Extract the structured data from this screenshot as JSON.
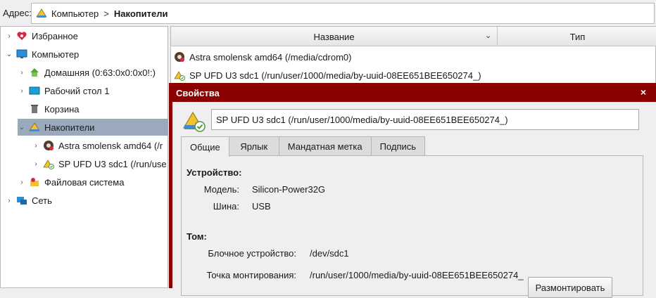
{
  "address": {
    "label": "Адрес:",
    "crumbs": [
      "Компьютер",
      "Накопители"
    ],
    "separator": ">"
  },
  "tree": {
    "items": [
      {
        "label": "Избранное",
        "icon": "heart-icon"
      },
      {
        "label": "Компьютер",
        "icon": "monitor-icon"
      },
      {
        "label": "Домашняя (0:63:0x0:0x0!:)",
        "icon": "home-icon"
      },
      {
        "label": "Рабочий стол 1",
        "icon": "desktop-icon"
      },
      {
        "label": "Корзина",
        "icon": "trash-icon"
      },
      {
        "label": "Накопители",
        "icon": "drives-icon"
      },
      {
        "label": "Astra smolensk amd64 (/r",
        "icon": "cdrom-icon"
      },
      {
        "label": "SP UFD U3 sdc1 (/run/use",
        "icon": "usb-drive-icon"
      },
      {
        "label": "Файловая система",
        "icon": "filesystem-icon"
      },
      {
        "label": "Сеть",
        "icon": "network-icon"
      }
    ]
  },
  "list": {
    "columns": {
      "name": "Название",
      "type": "Тип"
    },
    "rows": [
      {
        "name": "Astra smolensk amd64 (/media/cdrom0)",
        "icon": "cdrom-icon"
      },
      {
        "name": "SP UFD U3 sdc1 (/run/user/1000/media/by-uuid-08EE651BEE650274_)",
        "icon": "usb-drive-icon"
      }
    ]
  },
  "dialog": {
    "title": "Свойства",
    "close": "×",
    "name_value": "SP UFD U3 sdc1 (/run/user/1000/media/by-uuid-08EE651BEE650274_)",
    "tabs": [
      "Общие",
      "Ярлык",
      "Мандатная метка",
      "Подпись"
    ],
    "device": {
      "heading": "Устройство:",
      "model_label": "Модель:",
      "model_value": "Silicon-Power32G",
      "bus_label": "Шина:",
      "bus_value": "USB"
    },
    "volume": {
      "heading": "Том:",
      "block_label": "Блочное устройство:",
      "block_value": "/dev/sdc1",
      "mount_label": "Точка монтирования:",
      "mount_value": "/run/user/1000/media/by-uuid-08EE651BEE650274_",
      "unmount_button": "Размонтировать"
    }
  },
  "colors": {
    "dialog_frame": "#8b0000",
    "selection": "#9aa9bc"
  }
}
